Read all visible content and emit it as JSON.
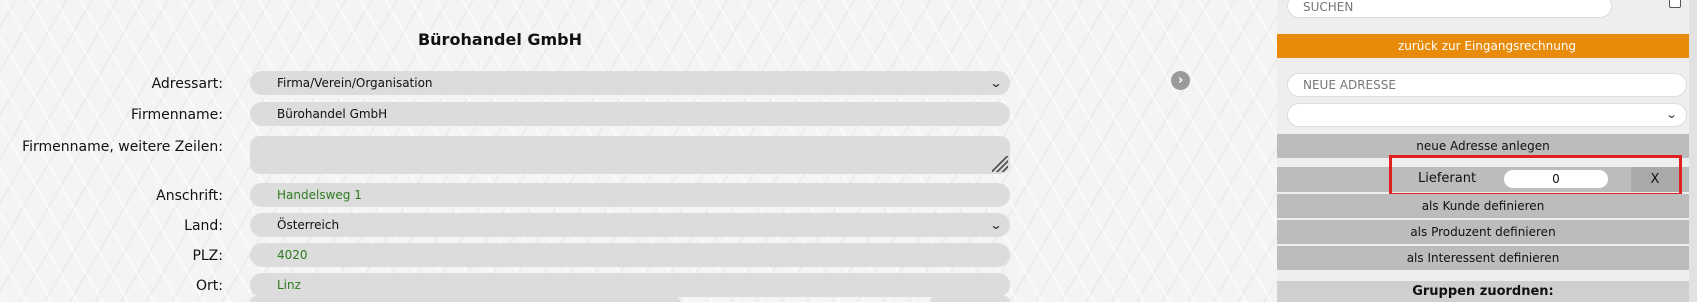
{
  "form": {
    "title": "Bürohandel GmbH",
    "fields": [
      {
        "label": "Adressart:",
        "value": "Firma/Verein/Organisation"
      },
      {
        "label": "Firmenname:",
        "value": "Bürohandel GmbH"
      },
      {
        "label": "Firmenname, weitere Zeilen:",
        "value": ""
      },
      {
        "label": "Anschrift:",
        "value": "Handelsweg 1"
      },
      {
        "label": "Land:",
        "value": "Österreich"
      },
      {
        "label": "PLZ:",
        "value": "4020"
      },
      {
        "label": "Ort:",
        "value": "Linz"
      }
    ]
  },
  "sidebar": {
    "search_placeholder": "SUCHEN",
    "back_button": "zurück zur Eingangsrechnung",
    "new_address_placeholder": "NEUE ADRESSE",
    "create_button": "neue Adresse anlegen",
    "supplier": {
      "label": "Lieferant",
      "value": "0",
      "remove": "X"
    },
    "define_customer": "als Kunde definieren",
    "define_producer": "als Produzent definieren",
    "define_prospect": "als Interessent definieren",
    "groups_title": "Gruppen zuordnen:"
  },
  "colors": {
    "accent_orange": "#e88a0a",
    "highlight_red": "#e02020",
    "field_green": "#2e7a1f"
  }
}
